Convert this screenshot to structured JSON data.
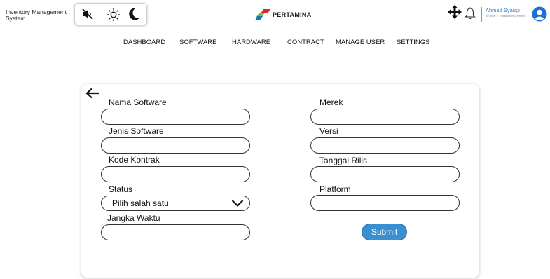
{
  "app": {
    "title_line1": "Inventory Management",
    "title_line2": "System"
  },
  "mode_controls": [
    {
      "icon": "mute-icon",
      "label": "mute"
    },
    {
      "icon": "sun-icon",
      "label": "light mode"
    },
    {
      "icon": "moon-icon",
      "label": "dark mode"
    }
  ],
  "brand": {
    "name": "PERTAMINA",
    "colors": {
      "red": "#e0262a",
      "green": "#82b541",
      "blue": "#1b75bc"
    }
  },
  "header_icons": [
    "move-icon",
    "bell-icon",
    "user-avatar-icon"
  ],
  "user": {
    "name": "Ahmad Syaugi",
    "role": "Sr Officer IT Infrastructure & Network"
  },
  "nav": {
    "dashboard": "DASHBOARD",
    "software": "SOFTWARE",
    "hardware": "HARDWARE",
    "contract": "CONTRACT",
    "manage_user": "MANAGE USER",
    "settings": "SETTINGS"
  },
  "form": {
    "back_icon": "arrow-left-icon",
    "fields": {
      "nama_software": {
        "label": "Nama Software",
        "value": ""
      },
      "jenis_software": {
        "label": "Jenis Software",
        "value": ""
      },
      "kode_kontrak": {
        "label": "Kode Kontrak",
        "value": ""
      },
      "status": {
        "label": "Status",
        "selected": "Pilih salah satu"
      },
      "jangka_waktu": {
        "label": "Jangka Waktu",
        "value": ""
      },
      "merek": {
        "label": "Merek",
        "value": ""
      },
      "versi": {
        "label": "Versi",
        "value": ""
      },
      "tanggal_rilis": {
        "label": "Tanggal Rilis",
        "value": ""
      },
      "platform": {
        "label": "Platform",
        "value": ""
      }
    },
    "submit_label": "Submit"
  },
  "colors": {
    "accent": "#3a8fd1",
    "user_name": "#2f7ed8"
  }
}
